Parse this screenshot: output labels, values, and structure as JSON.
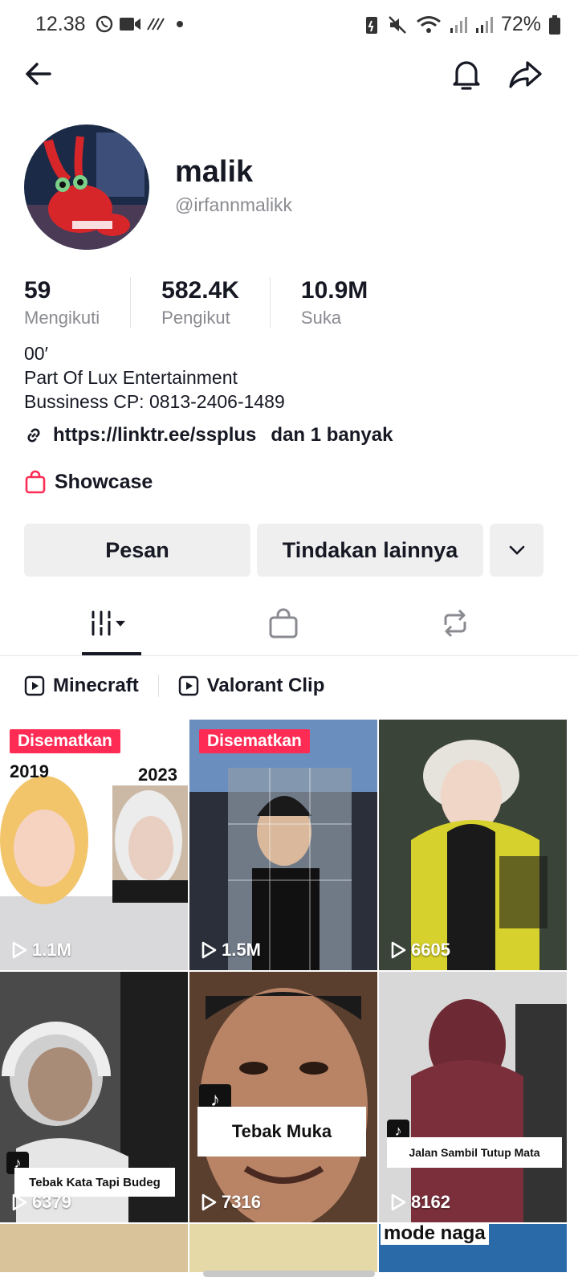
{
  "status": {
    "time": "12.38",
    "battery": "72%"
  },
  "profile": {
    "name": "malik",
    "handle": "@irfannmalikk",
    "stats": [
      {
        "num": "59",
        "label": "Mengikuti"
      },
      {
        "num": "582.4K",
        "label": "Pengikut"
      },
      {
        "num": "10.9M",
        "label": "Suka"
      }
    ],
    "bio": [
      "00′",
      "Part Of Lux Entertainment",
      "Bussiness CP: 0813-2406-1489"
    ],
    "link": "https://linktr.ee/ssplus",
    "link_extra": "dan 1 banyak",
    "showcase": "Showcase"
  },
  "actions": {
    "message": "Pesan",
    "more_actions": "Tindakan lainnya"
  },
  "playlists": [
    "Minecraft",
    "Valorant Clip"
  ],
  "videos": [
    {
      "pinned": "Disematkan",
      "views": "1.1M",
      "year_left": "2019",
      "year_right": "2023"
    },
    {
      "pinned": "Disematkan",
      "views": "1.5M"
    },
    {
      "views": "6605"
    },
    {
      "views": "6379",
      "caption": "Tebak Kata Tapi Budeg"
    },
    {
      "views": "7316",
      "caption": "Tebak Muka"
    },
    {
      "views": "8162",
      "caption": "Jalan Sambil Tutup Mata"
    },
    {
      "caption": "mode naga"
    }
  ],
  "colors": {
    "accent": "#fe2c55",
    "button_bg": "#efeff0",
    "text": "#161823",
    "muted": "#8a8b91"
  }
}
